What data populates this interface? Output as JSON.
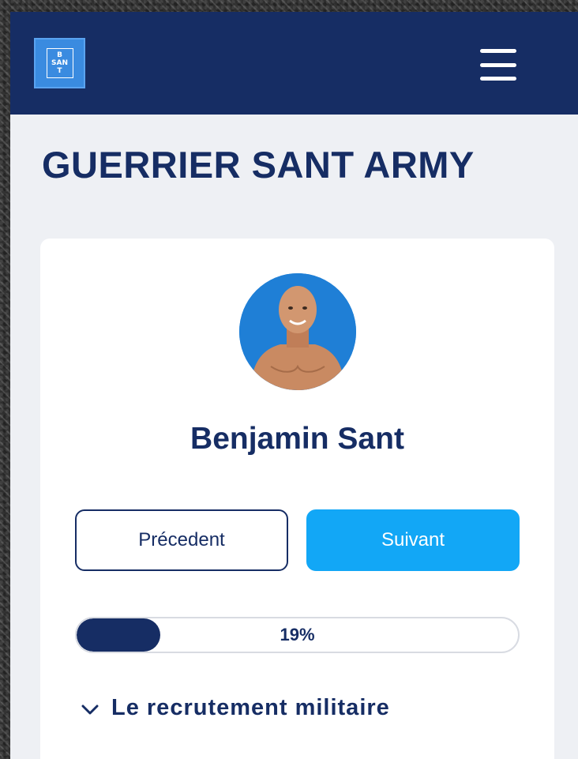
{
  "header": {
    "logo_lines": [
      "B",
      "SAN",
      "T"
    ],
    "menu_icon": "hamburger-menu-icon"
  },
  "page": {
    "title": "GUERRIER SANT ARMY"
  },
  "profile": {
    "name": "Benjamin Sant",
    "avatar_icon": "profile-photo"
  },
  "navigation": {
    "prev_label": "Précedent",
    "next_label": "Suivant"
  },
  "progress": {
    "value_percent": 19,
    "label": "19%"
  },
  "section": {
    "chevron_icon": "chevron-down-icon",
    "label": "Le recrutement militaire"
  },
  "colors": {
    "navy": "#162d64",
    "accent_blue": "#12a7f6",
    "logo_blue": "#3a8be0",
    "page_bg": "#eef0f4"
  }
}
